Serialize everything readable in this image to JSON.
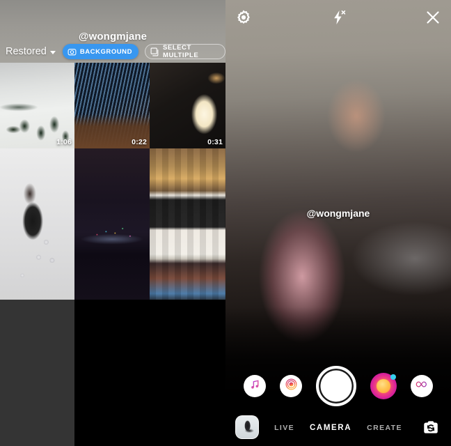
{
  "gallery": {
    "username": "@wongmjane",
    "album_selector": {
      "label": "Restored",
      "icon": "chevron-down-icon"
    },
    "background_button": {
      "label": "BACKGROUND",
      "icon": "camera-icon",
      "accent_color": "#3897f0"
    },
    "select_multiple_button": {
      "label": "SELECT MULTIPLE",
      "icon": "stacked-squares-icon"
    },
    "grid": [
      {
        "name": "snowy-mountain-video",
        "duration": "1:06",
        "art": "th-snow"
      },
      {
        "name": "keyboard-video",
        "duration": "0:22",
        "art": "th-keyboard"
      },
      {
        "name": "candle-video",
        "duration": "0:31",
        "art": "th-candle"
      },
      {
        "name": "ball-pit-photo",
        "duration": "",
        "art": "th-ballpit"
      },
      {
        "name": "city-night-skyline-photo",
        "duration": "",
        "art": "th-city"
      },
      {
        "name": "fridge-shelf-photo",
        "duration": "",
        "art": "th-fridge"
      }
    ]
  },
  "camera": {
    "top_bar": {
      "settings_icon": "gear-icon",
      "flash_icon": "flash-off-icon",
      "close_icon": "close-icon"
    },
    "watermark": "@wongmjane",
    "effects": [
      {
        "name": "music-effect",
        "icon": "music-note-icon"
      },
      {
        "name": "boomerang-effect",
        "icon": "boomerang-icon"
      },
      {
        "name": "shutter",
        "icon": "shutter-icon"
      },
      {
        "name": "superzoom-effect",
        "icon": "superzoom-orb-icon"
      },
      {
        "name": "rewind-effect",
        "icon": "infinity-icon"
      }
    ],
    "bottom_bar": {
      "gallery_thumb": "gallery-thumbnail",
      "modes": [
        {
          "label": "LIVE",
          "active": false
        },
        {
          "label": "CAMERA",
          "active": true
        },
        {
          "label": "CREATE",
          "active": false
        }
      ],
      "flip_icon": "flip-camera-icon"
    }
  }
}
